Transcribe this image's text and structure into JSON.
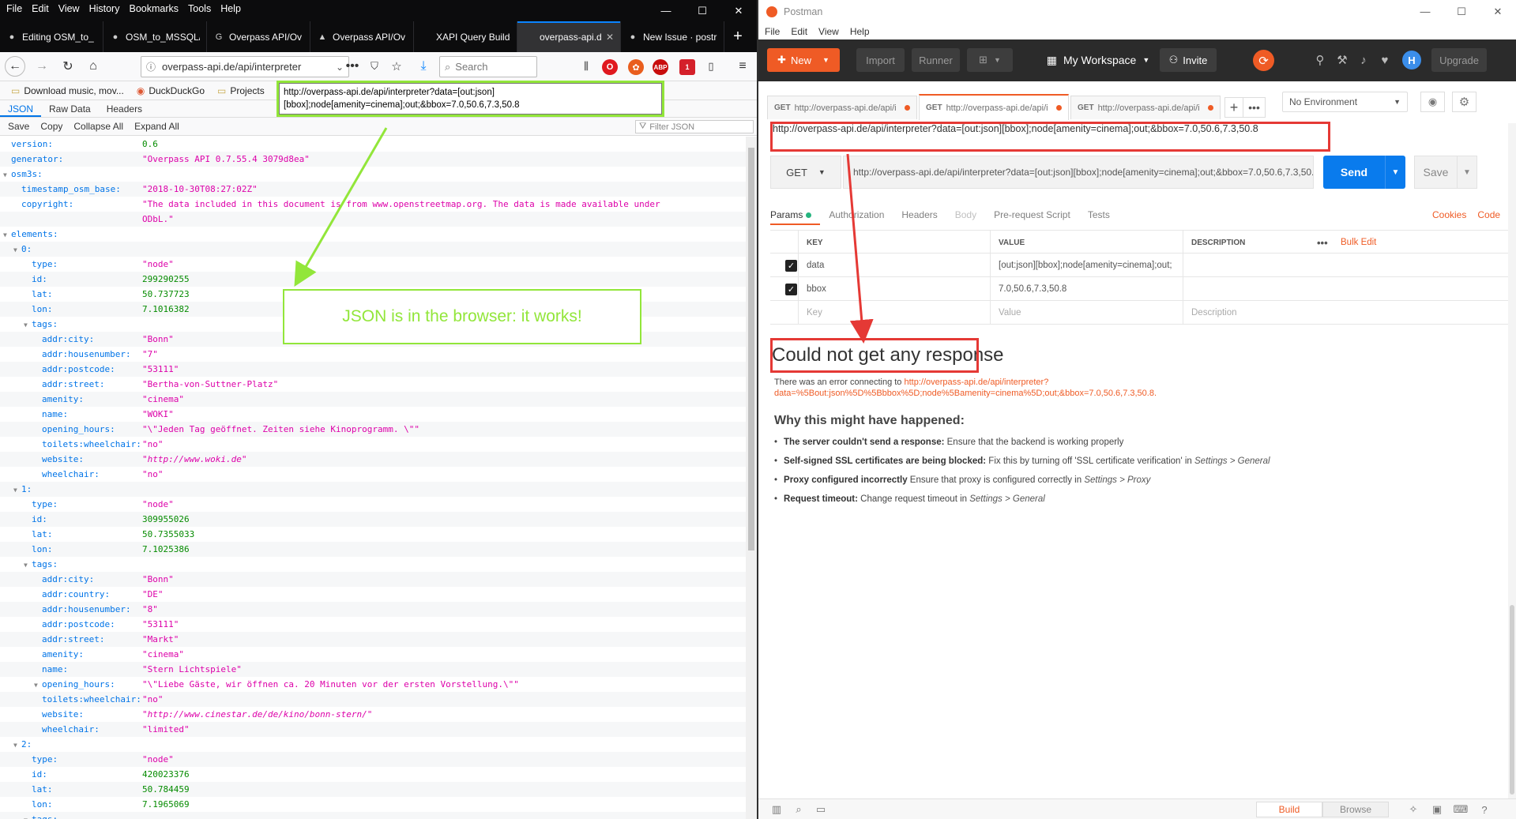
{
  "firefox": {
    "menu": [
      "File",
      "Edit",
      "View",
      "History",
      "Bookmarks",
      "Tools",
      "Help"
    ],
    "tabs": [
      {
        "title": "Editing OSM_to_",
        "icon": "github-icon",
        "active": false
      },
      {
        "title": "OSM_to_MSSQL/",
        "icon": "github-icon",
        "active": false
      },
      {
        "title": "Overpass API/Ov",
        "icon": "google-icon",
        "active": false
      },
      {
        "title": "Overpass API/Ov",
        "icon": "osm-icon",
        "active": false
      },
      {
        "title": "XAPI Query Builder",
        "icon": "",
        "active": false
      },
      {
        "title": "overpass-api.de/a",
        "icon": "",
        "active": true
      },
      {
        "title": "New Issue · postr",
        "icon": "github-icon",
        "active": false
      }
    ],
    "url": "overpass-api.de/api/interpreter",
    "search_placeholder": "Search",
    "bookmarks": [
      {
        "label": "Download music, mov...",
        "icon": "folder-icon"
      },
      {
        "label": "DuckDuckGo",
        "icon": "duckduckgo-icon"
      },
      {
        "label": "Projects",
        "icon": "folder-icon"
      }
    ],
    "tooltip": "http://overpass-api.de/api/interpreter?data=[out:json][bbox];node[amenity=cinema];out;&bbox=7.0,50.6,7.3,50.8",
    "json_tabs": [
      "JSON",
      "Raw Data",
      "Headers"
    ],
    "json_actions": [
      "Save",
      "Copy",
      "Collapse All",
      "Expand All"
    ],
    "filter_placeholder": "Filter JSON",
    "extension_badge": "1",
    "json_rows": [
      {
        "indent": 0,
        "key": "version:",
        "val": "0.6",
        "type": "num",
        "twisty": false
      },
      {
        "indent": 0,
        "key": "generator:",
        "val": "\"Overpass API 0.7.55.4 3079d8ea\"",
        "type": "str",
        "twisty": false
      },
      {
        "indent": 0,
        "key": "osm3s:",
        "val": "",
        "type": "",
        "twisty": true
      },
      {
        "indent": 1,
        "key": "timestamp_osm_base:",
        "val": "\"2018-10-30T08:27:02Z\"",
        "type": "str",
        "twisty": false
      },
      {
        "indent": 1,
        "key": "copyright:",
        "val": "\"The data included in this document is from www.openstreetmap.org. The data is made available under",
        "type": "str",
        "twisty": false
      },
      {
        "indent": 1,
        "key": "",
        "val": "ODbL.\"",
        "type": "str",
        "twisty": false
      },
      {
        "indent": 0,
        "key": "elements:",
        "val": "",
        "type": "",
        "twisty": true
      },
      {
        "indent": 1,
        "key": "0:",
        "val": "",
        "type": "",
        "twisty": true
      },
      {
        "indent": 2,
        "key": "type:",
        "val": "\"node\"",
        "type": "str",
        "twisty": false
      },
      {
        "indent": 2,
        "key": "id:",
        "val": "299290255",
        "type": "num",
        "twisty": false
      },
      {
        "indent": 2,
        "key": "lat:",
        "val": "50.737723",
        "type": "num",
        "twisty": false
      },
      {
        "indent": 2,
        "key": "lon:",
        "val": "7.1016382",
        "type": "num",
        "twisty": false
      },
      {
        "indent": 2,
        "key": "tags:",
        "val": "",
        "type": "",
        "twisty": true
      },
      {
        "indent": 3,
        "key": "addr:city:",
        "val": "\"Bonn\"",
        "type": "str",
        "twisty": false
      },
      {
        "indent": 3,
        "key": "addr:housenumber:",
        "val": "\"7\"",
        "type": "str",
        "twisty": false
      },
      {
        "indent": 3,
        "key": "addr:postcode:",
        "val": "\"53111\"",
        "type": "str",
        "twisty": false
      },
      {
        "indent": 3,
        "key": "addr:street:",
        "val": "\"Bertha-von-Suttner-Platz\"",
        "type": "str",
        "twisty": false
      },
      {
        "indent": 3,
        "key": "amenity:",
        "val": "\"cinema\"",
        "type": "str",
        "twisty": false
      },
      {
        "indent": 3,
        "key": "name:",
        "val": "\"WOKI\"",
        "type": "str",
        "twisty": false
      },
      {
        "indent": 3,
        "key": "opening_hours:",
        "val": "\"\\\"Jeden Tag geöffnet. Zeiten siehe Kinoprogramm. \\\"\"",
        "type": "str",
        "twisty": false
      },
      {
        "indent": 3,
        "key": "toilets:wheelchair:",
        "val": "\"no\"",
        "type": "str",
        "twisty": false
      },
      {
        "indent": 3,
        "key": "website:",
        "val": "\"http://www.woki.de\"",
        "type": "url",
        "twisty": false
      },
      {
        "indent": 3,
        "key": "wheelchair:",
        "val": "\"no\"",
        "type": "str",
        "twisty": false
      },
      {
        "indent": 1,
        "key": "1:",
        "val": "",
        "type": "",
        "twisty": true
      },
      {
        "indent": 2,
        "key": "type:",
        "val": "\"node\"",
        "type": "str",
        "twisty": false
      },
      {
        "indent": 2,
        "key": "id:",
        "val": "309955026",
        "type": "num",
        "twisty": false
      },
      {
        "indent": 2,
        "key": "lat:",
        "val": "50.7355033",
        "type": "num",
        "twisty": false
      },
      {
        "indent": 2,
        "key": "lon:",
        "val": "7.1025386",
        "type": "num",
        "twisty": false
      },
      {
        "indent": 2,
        "key": "tags:",
        "val": "",
        "type": "",
        "twisty": true
      },
      {
        "indent": 3,
        "key": "addr:city:",
        "val": "\"Bonn\"",
        "type": "str",
        "twisty": false
      },
      {
        "indent": 3,
        "key": "addr:country:",
        "val": "\"DE\"",
        "type": "str",
        "twisty": false
      },
      {
        "indent": 3,
        "key": "addr:housenumber:",
        "val": "\"8\"",
        "type": "str",
        "twisty": false
      },
      {
        "indent": 3,
        "key": "addr:postcode:",
        "val": "\"53111\"",
        "type": "str",
        "twisty": false
      },
      {
        "indent": 3,
        "key": "addr:street:",
        "val": "\"Markt\"",
        "type": "str",
        "twisty": false
      },
      {
        "indent": 3,
        "key": "amenity:",
        "val": "\"cinema\"",
        "type": "str",
        "twisty": false
      },
      {
        "indent": 3,
        "key": "name:",
        "val": "\"Stern Lichtspiele\"",
        "type": "str",
        "twisty": false
      },
      {
        "indent": 3,
        "key": "opening_hours:",
        "val": "\"\\\"Liebe Gäste, wir öffnen ca. 20 Minuten vor der ersten Vorstellung.\\\"\"",
        "type": "str",
        "twisty": true
      },
      {
        "indent": 3,
        "key": "toilets:wheelchair:",
        "val": "\"no\"",
        "type": "str",
        "twisty": false
      },
      {
        "indent": 3,
        "key": "website:",
        "val": "\"http://www.cinestar.de/de/kino/bonn-stern/\"",
        "type": "url",
        "twisty": false
      },
      {
        "indent": 3,
        "key": "wheelchair:",
        "val": "\"limited\"",
        "type": "str",
        "twisty": false
      },
      {
        "indent": 1,
        "key": "2:",
        "val": "",
        "type": "",
        "twisty": true
      },
      {
        "indent": 2,
        "key": "type:",
        "val": "\"node\"",
        "type": "str",
        "twisty": false
      },
      {
        "indent": 2,
        "key": "id:",
        "val": "420023376",
        "type": "num",
        "twisty": false
      },
      {
        "indent": 2,
        "key": "lat:",
        "val": "50.784459",
        "type": "num",
        "twisty": false
      },
      {
        "indent": 2,
        "key": "lon:",
        "val": "7.1965069",
        "type": "num",
        "twisty": false
      },
      {
        "indent": 2,
        "key": "tags:",
        "val": "",
        "type": "",
        "twisty": true
      }
    ]
  },
  "annotation": {
    "works_text": "JSON is in the browser: it works!"
  },
  "postman": {
    "title": "Postman",
    "menu": [
      "File",
      "Edit",
      "View",
      "Help"
    ],
    "header": {
      "new_label": "New",
      "import_label": "Import",
      "runner_label": "Runner",
      "workspace_label": "My Workspace",
      "invite_label": "Invite",
      "upgrade_label": "Upgrade",
      "avatar_letter": "H"
    },
    "tabs": [
      {
        "method": "GET",
        "title": "http://overpass-api.de/api/i",
        "active": false
      },
      {
        "method": "GET",
        "title": "http://overpass-api.de/api/i",
        "active": true
      },
      {
        "method": "GET",
        "title": "http://overpass-api.de/api/i",
        "active": false
      }
    ],
    "environment": "No Environment",
    "request_name": "http://overpass-api.de/api/interpreter?data=[out:json][bbox];node[amenity=cinema];out;&bbox=7.0,50.6,7.3,50.8",
    "method": "GET",
    "url_input": "http://overpass-api.de/api/interpreter?data=[out:json][bbox];node[amenity=cinema];out;&bbox=7.0,50.6,7.3,50.8",
    "send_label": "Send",
    "save_label": "Save",
    "subtabs": [
      "Params",
      "Authorization",
      "Headers",
      "Body",
      "Pre-request Script",
      "Tests"
    ],
    "cookies_label": "Cookies",
    "code_label": "Code",
    "table_headers": {
      "key": "KEY",
      "value": "VALUE",
      "description": "DESCRIPTION",
      "bulk_edit": "Bulk Edit"
    },
    "params": [
      {
        "key": "data",
        "value": "[out:json][bbox];node[amenity=cinema];out;",
        "checked": true
      },
      {
        "key": "bbox",
        "value": "7.0,50.6,7.3,50.8",
        "checked": true
      }
    ],
    "placeholders": {
      "key": "Key",
      "value": "Value",
      "description": "Description"
    },
    "no_response": "Could not get any response",
    "error_prefix": "There was an error connecting to ",
    "error_url": "http://overpass-api.de/api/interpreter?data=%5Bout:json%5D%5Bbbox%5D;node%5Bamenity=cinema%5D;out;&bbox=7.0,50.6,7.3,50.8.",
    "why_title": "Why this might have happened:",
    "reasons": [
      {
        "bold": "The server couldn't send a response:",
        "text": " Ensure that the backend is working properly",
        "italic": ""
      },
      {
        "bold": "Self-signed SSL certificates are being blocked:",
        "text": " Fix this by turning off 'SSL certificate verification' in ",
        "italic": "Settings > General"
      },
      {
        "bold": "Proxy configured incorrectly",
        "text": " Ensure that proxy is configured correctly in ",
        "italic": "Settings > Proxy"
      },
      {
        "bold": "Request timeout:",
        "text": " Change request timeout in ",
        "italic": "Settings > General"
      }
    ],
    "footer": {
      "build_label": "Build",
      "browse_label": "Browse"
    }
  }
}
